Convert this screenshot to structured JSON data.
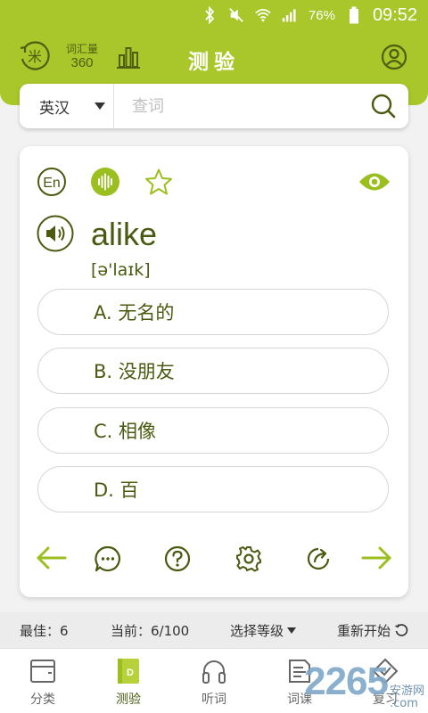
{
  "status_bar": {
    "battery_percent": "76%",
    "time": "09:52"
  },
  "header": {
    "title": "测验",
    "vocab_label": "词汇量",
    "vocab_count": "360",
    "rice_icon_char": "米"
  },
  "search": {
    "lang_label": "英汉",
    "placeholder": "查词"
  },
  "quiz": {
    "lang_badge": "En",
    "word": "alike",
    "phonetic": "[ə'laɪk]",
    "options": [
      {
        "label": "A. 无名的"
      },
      {
        "label": "B. 没朋友"
      },
      {
        "label": "C. 相像"
      },
      {
        "label": "D. 百"
      }
    ]
  },
  "stats": {
    "best": "最佳：6",
    "current": "当前：6/100",
    "level_select": "选择等级",
    "restart": "重新开始"
  },
  "tabs": [
    {
      "label": "分类",
      "icon": "category-icon"
    },
    {
      "label": "测验",
      "icon": "quiz-icon"
    },
    {
      "label": "听词",
      "icon": "headphones-icon"
    },
    {
      "label": "词课",
      "icon": "lesson-icon"
    },
    {
      "label": "复习",
      "icon": "review-icon"
    }
  ],
  "watermark": {
    "number": "2265",
    "suffix_text": "安游网",
    "domain": ".com"
  },
  "colors": {
    "accent": "#a9c72a",
    "dark_green": "#4a5a10",
    "icon_green": "#9bbf1f"
  }
}
